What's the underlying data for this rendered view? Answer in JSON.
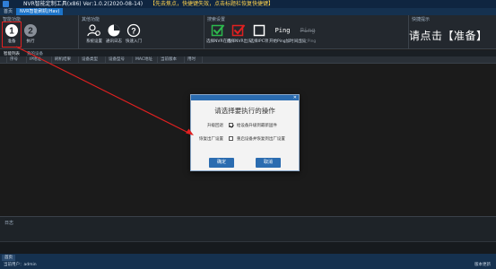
{
  "window": {
    "title": "NVR智能定制工具(x86)   Ver:1.0.2(2020-08-14)",
    "warning": "【先去焦点，快捷键失效，点击标题栏恢复快捷键】"
  },
  "menubar": {
    "items": [
      {
        "label": "首页",
        "active": false
      },
      {
        "label": "NVR智能刷机(Hav)",
        "active": true
      }
    ]
  },
  "ribbon": {
    "groups": [
      {
        "title": "智能功能",
        "buttons": [
          {
            "label": "准备",
            "icon": "number-one-icon"
          },
          {
            "label": "执行",
            "icon": "number-two-icon"
          }
        ]
      },
      {
        "title": "其他功能",
        "buttons": [
          {
            "label": "系统设置",
            "icon": "settings-user-icon"
          },
          {
            "label": "通讯日志",
            "icon": "pie-chart-icon"
          },
          {
            "label": "快速入门",
            "icon": "help-icon"
          }
        ]
      },
      {
        "title": "搜索设置",
        "buttons": [
          {
            "label": "选择NVR在线",
            "icon": "checkbox-green-icon"
          },
          {
            "label": "选择NVR出头",
            "icon": "checkbox-red-icon"
          },
          {
            "label": "选择IPC项",
            "icon": "checkbox-empty-icon"
          },
          {
            "label": "开始Ping加时间出头",
            "icon": "ping-icon"
          },
          {
            "label": "停止Ping",
            "icon": "ping-disabled-icon"
          }
        ]
      },
      {
        "title": "快捷提示",
        "hint": "请点击【准备】"
      }
    ],
    "ping_text": "Ping",
    "ping_disabled_text": "Ping"
  },
  "tabs": [
    {
      "label": "智能列表",
      "active": true
    },
    {
      "label": "我的设备",
      "active": false
    }
  ],
  "table": {
    "columns": [
      "",
      "序号",
      "IP地址",
      "刷机结果",
      "设备类型",
      "设备型号",
      "MAC地址",
      "当前版本",
      "用时"
    ]
  },
  "dialog": {
    "title": "请选择要执行的操作",
    "options": [
      {
        "label": "升级回退",
        "text": "给设备升级到最新固件",
        "checked": true
      },
      {
        "label": "恢复出厂设置",
        "text": "重启设备并恢复到出厂设置",
        "checked": false
      }
    ],
    "ok_label": "确定",
    "cancel_label": "取消"
  },
  "log": {
    "header": "日志"
  },
  "statusbar": {
    "tab": "首页",
    "left_text": "当前用户：admin",
    "right_text": "版本更新"
  },
  "colors": {
    "accent": "#2b6cb0",
    "highlight": "#e02020",
    "green": "#2db84d",
    "red": "#e02020"
  }
}
